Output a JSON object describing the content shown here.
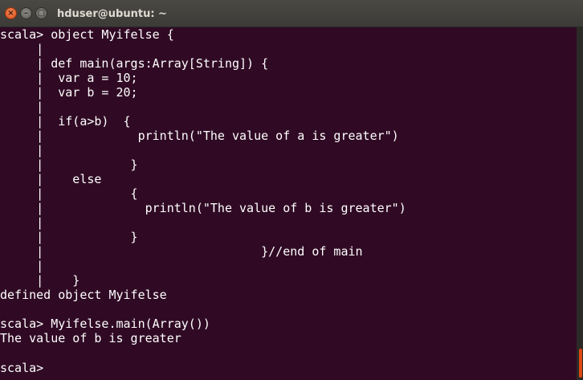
{
  "window": {
    "title": "hduser@ubuntu: ~",
    "controls": {
      "close_glyph": "×",
      "minimize_glyph": "–",
      "maximize_glyph": "□"
    }
  },
  "terminal": {
    "background_color": "#300a24",
    "text_color": "#ffffff",
    "lines": [
      "scala> object Myifelse {",
      "     |",
      "     | def main(args:Array[String]) {",
      "     |  var a = 10;",
      "     |  var b = 20;",
      "     |",
      "     |  if(a>b)  {",
      "     |             println(\"The value of a is greater\")",
      "     |",
      "     |            }",
      "     |    else",
      "     |            {",
      "     |              println(\"The value of b is greater\")",
      "     |",
      "     |            }",
      "     |                              }//end of main",
      "     |",
      "     |    }",
      "defined object Myifelse",
      "",
      "scala> Myifelse.main(Array())",
      "The value of b is greater",
      "",
      "scala> "
    ]
  },
  "scrollbar": {
    "accent_color": "#dd4814"
  }
}
